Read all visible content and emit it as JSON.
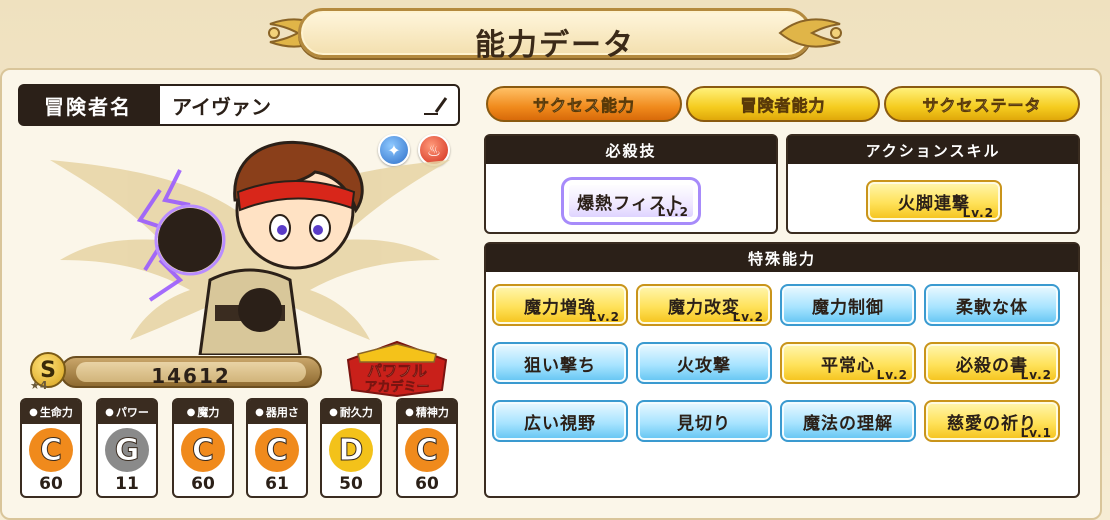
{
  "title": "能力データ",
  "adventurer": {
    "label": "冒険者名",
    "name": "アイヴァン"
  },
  "rank": {
    "grade": "S",
    "stars": "★4",
    "power": "14612"
  },
  "academy_badge": {
    "line1": "パワフル",
    "line2": "アカデミー"
  },
  "stats": [
    {
      "label": "生命力",
      "icon": "heart-icon",
      "grade": "C",
      "value": "60",
      "color": "#f08a1c"
    },
    {
      "label": "パワー",
      "icon": "arm-icon",
      "grade": "G",
      "value": "11",
      "color": "#8a8a8a"
    },
    {
      "label": "魔力",
      "icon": "magic-hand-icon",
      "grade": "C",
      "value": "60",
      "color": "#f08a1c"
    },
    {
      "label": "器用さ",
      "icon": "hand-icon",
      "grade": "C",
      "value": "61",
      "color": "#f08a1c"
    },
    {
      "label": "耐久力",
      "icon": "shield-icon",
      "grade": "D",
      "value": "50",
      "color": "#f3c21a"
    },
    {
      "label": "精神力",
      "icon": "spirit-icon",
      "grade": "C",
      "value": "60",
      "color": "#f08a1c"
    }
  ],
  "tabs": [
    {
      "label": "サクセス能力",
      "active": true
    },
    {
      "label": "冒険者能力",
      "active": false
    },
    {
      "label": "サクセステータ",
      "active": false
    }
  ],
  "finisher": {
    "header": "必殺技",
    "skill": "爆熱フィスト",
    "level": "Lv.2"
  },
  "action_skill": {
    "header": "アクションスキル",
    "skill": "火脚連撃",
    "level": "Lv.2"
  },
  "special": {
    "header": "特殊能力",
    "skills": [
      {
        "name": "魔力増強",
        "style": "gold",
        "level": "Lv.2"
      },
      {
        "name": "魔力改変",
        "style": "gold",
        "level": "Lv.2"
      },
      {
        "name": "魔力制御",
        "style": "blue",
        "level": ""
      },
      {
        "name": "柔軟な体",
        "style": "blue",
        "level": ""
      },
      {
        "name": "狙い撃ち",
        "style": "blue",
        "level": ""
      },
      {
        "name": "火攻撃",
        "style": "blue",
        "level": ""
      },
      {
        "name": "平常心",
        "style": "gold",
        "level": "Lv.2"
      },
      {
        "name": "必殺の書",
        "style": "gold",
        "level": "Lv.2"
      },
      {
        "name": "広い視野",
        "style": "blue",
        "level": ""
      },
      {
        "name": "見切り",
        "style": "blue",
        "level": ""
      },
      {
        "name": "魔法の理解",
        "style": "blue",
        "level": ""
      },
      {
        "name": "慈愛の祈り",
        "style": "gold",
        "level": "Lv.1"
      }
    ]
  },
  "colors": {
    "dark": "#2b2018",
    "gold": "#f4c21a",
    "orange": "#f08a1c",
    "blue": "#62c4f2"
  }
}
